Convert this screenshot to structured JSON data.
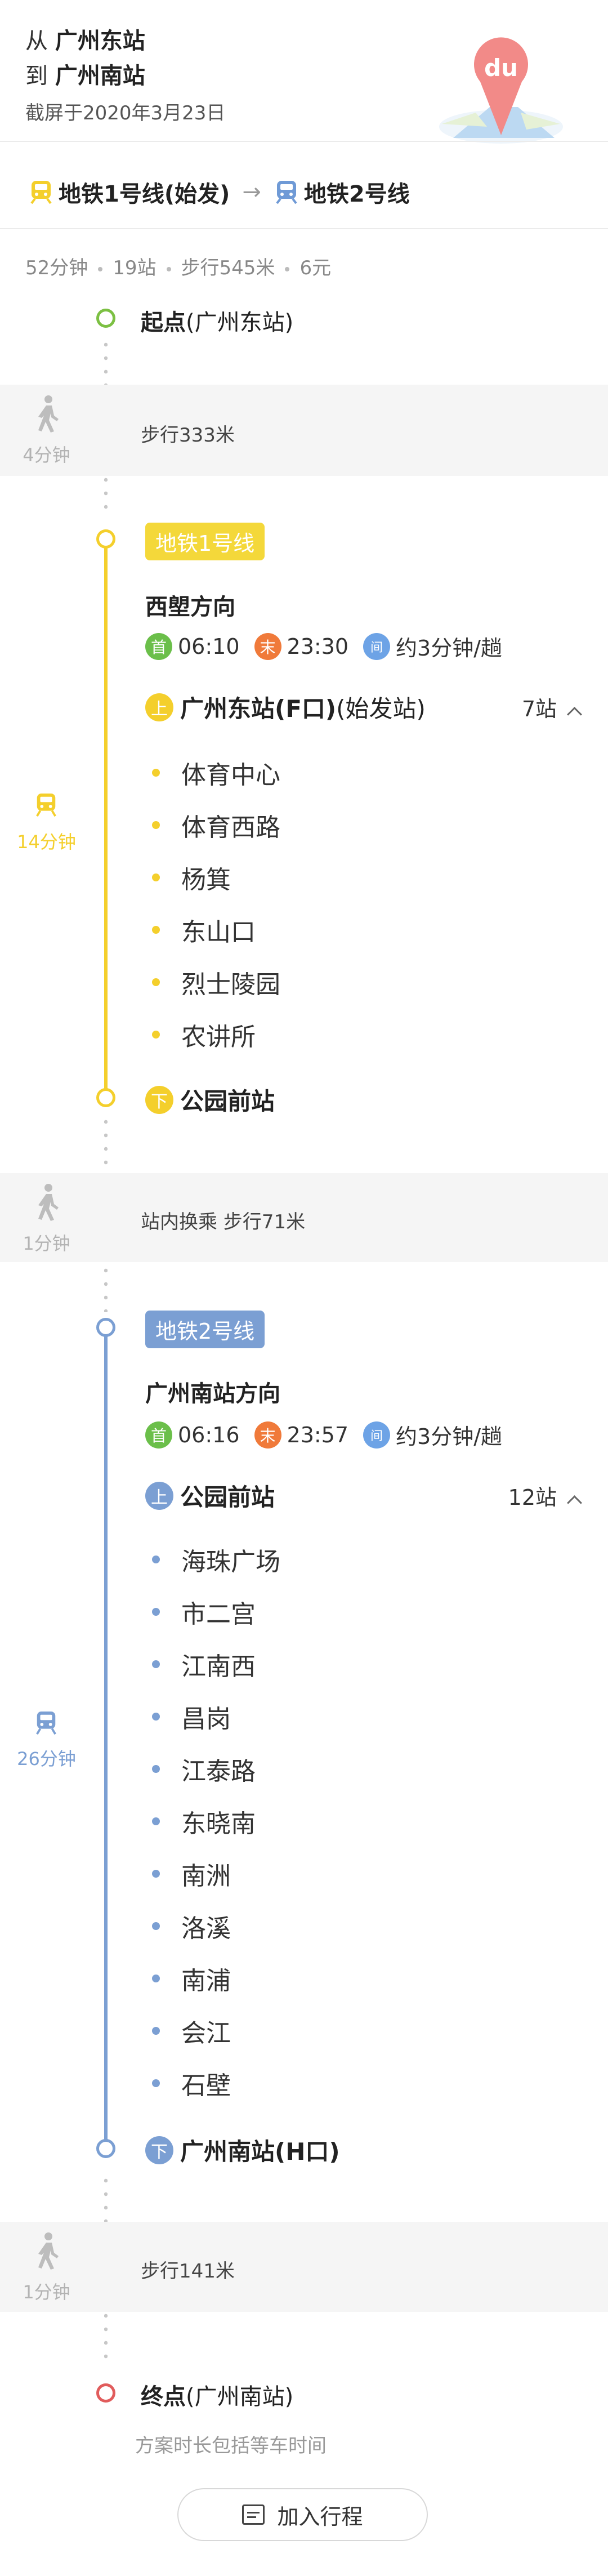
{
  "header": {
    "from_prefix": "从",
    "from_station": "广州东站",
    "to_prefix": "到",
    "to_station": "广州南站",
    "screenshot_date": "截屏于2020年3月23日",
    "logo_text": "du"
  },
  "route": {
    "line1": "地铁1号线(始发)",
    "arrow": "→",
    "line2": "地铁2号线"
  },
  "summary": {
    "duration": "52分钟",
    "stops": "19站",
    "walk": "步行545米",
    "fare": "6元"
  },
  "start": {
    "label": "起点",
    "place": "(广州东站)"
  },
  "walk1": {
    "duration": "4分钟",
    "text": "步行333米"
  },
  "segment1": {
    "line": "地铁1号线",
    "direction": "西塱方向",
    "first_badge": "首",
    "first_time": "06:10",
    "last_badge": "末",
    "last_time": "23:30",
    "interval_badge": "间",
    "interval": "约3分钟/趟",
    "board_badge": "上",
    "board_station": "广州东站(F口)",
    "board_note": "(始发站)",
    "stop_count": "7站",
    "duration": "14分钟",
    "stops": [
      "体育中心",
      "体育西路",
      "杨箕",
      "东山口",
      "烈士陵园",
      "农讲所"
    ],
    "alight_badge": "下",
    "alight_station": "公园前站",
    "color": "#f4cf2c"
  },
  "transfer": {
    "duration": "1分钟",
    "text": "站内换乘 步行71米"
  },
  "segment2": {
    "line": "地铁2号线",
    "direction": "广州南站方向",
    "first_badge": "首",
    "first_time": "06:16",
    "last_badge": "末",
    "last_time": "23:57",
    "interval_badge": "间",
    "interval": "约3分钟/趟",
    "board_badge": "上",
    "board_station": "公园前站",
    "stop_count": "12站",
    "duration": "26分钟",
    "stops": [
      "海珠广场",
      "市二宫",
      "江南西",
      "昌岗",
      "江泰路",
      "东晓南",
      "南洲",
      "洛溪",
      "南浦",
      "会江",
      "石壁"
    ],
    "alight_badge": "下",
    "alight_station": "广州南站(H口)",
    "color": "#7b9fd3"
  },
  "walk2": {
    "duration": "1分钟",
    "text": "步行141米"
  },
  "end": {
    "label": "终点",
    "place": "(广州南站)"
  },
  "footer_note": "方案时长包括等车时间",
  "add_trip_label": "加入行程",
  "colors": {
    "start": "#7cc043",
    "end": "#e15c5c",
    "line1": "#f4cf2c",
    "line2": "#7b9fd3"
  }
}
